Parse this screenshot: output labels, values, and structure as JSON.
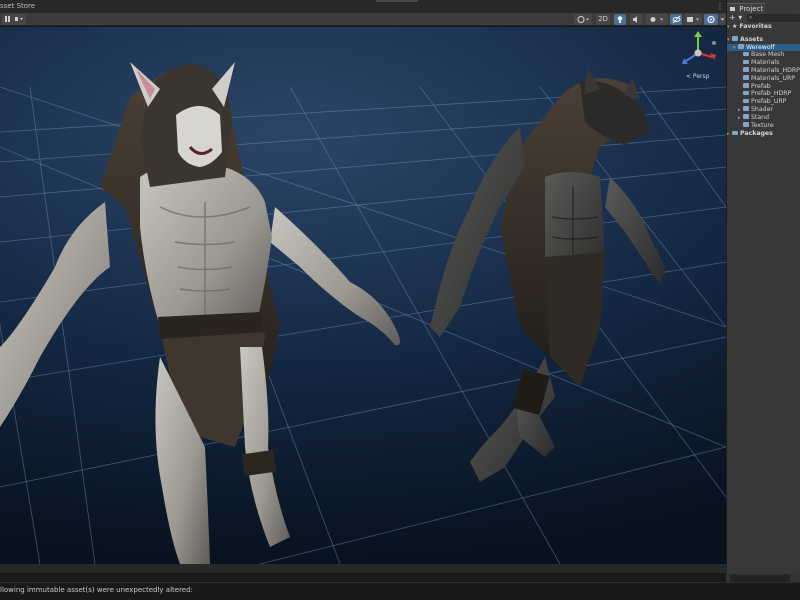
{
  "scene_tab": {
    "title": "sset Store"
  },
  "scene_toolbar": {
    "view_mode_label": "2D",
    "gizmo_persp_label": "< Persp",
    "gizmo_axes": {
      "x": "x",
      "y": "y",
      "z": "z"
    }
  },
  "project": {
    "tab_label": "Project",
    "add_label": "+ ▾",
    "search_icon": "search-icon",
    "favorites_label": "Favorites",
    "assets_label": "Assets",
    "werewolf_label": "Werewolf",
    "children": [
      "Base Mesh",
      "Materials",
      "Materials_HDRP",
      "Materials_URP",
      "Prefab",
      "Prefab_HDRP",
      "Prefab_URP",
      "Shader",
      "Stand",
      "Texture"
    ],
    "packages_label": "Packages"
  },
  "status": {
    "message": "llowing immutable asset(s) were unexpectedly altered:"
  },
  "colors": {
    "accent": "#4d6e94",
    "selection": "#2c5d87",
    "folder": "#7ea7c9",
    "panel": "#383838"
  }
}
